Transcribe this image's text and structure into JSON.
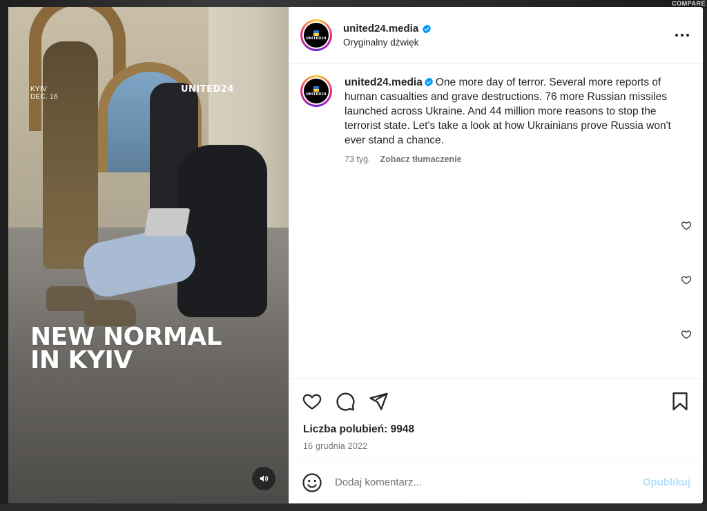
{
  "backdrop": {
    "right_label": "COMPARE"
  },
  "media": {
    "city_tag": "KYIV",
    "date_tag": "DEC. 16",
    "brand": "UNITED24",
    "headline_line1": "NEW NORMAL",
    "headline_line2": "IN KYIV",
    "sound_icon": "speaker-icon"
  },
  "header": {
    "avatar_word": "UNITED24",
    "avatar_sub": "MEDIA",
    "username": "united24.media",
    "audio": "Oryginalny dźwięk",
    "more_icon": "more-dots-icon"
  },
  "caption": {
    "username": "united24.media",
    "text": "One more day of terror. Several more reports of human casualties and grave destructions. 76 more Russian missiles launched across Ukraine. And 44 million more reasons to stop the terrorist state. Let's take a look at how Ukrainians prove Russia won't ever stand a chance.",
    "age": "73 tyg.",
    "translate": "Zobacz tłumaczenie"
  },
  "actions": {
    "like_icon": "heart-icon",
    "comment_icon": "comment-bubble-icon",
    "share_icon": "paper-plane-icon",
    "save_icon": "bookmark-icon"
  },
  "likes": {
    "label": "Liczba polubień: 9948",
    "date": "16 grudnia 2022"
  },
  "comment_box": {
    "placeholder": "Dodaj komentarz...",
    "publish": "Opublikuj"
  },
  "colors": {
    "verified": "#0095f6",
    "text": "#262626",
    "muted": "#737373",
    "publish_disabled": "#b2dffc"
  }
}
